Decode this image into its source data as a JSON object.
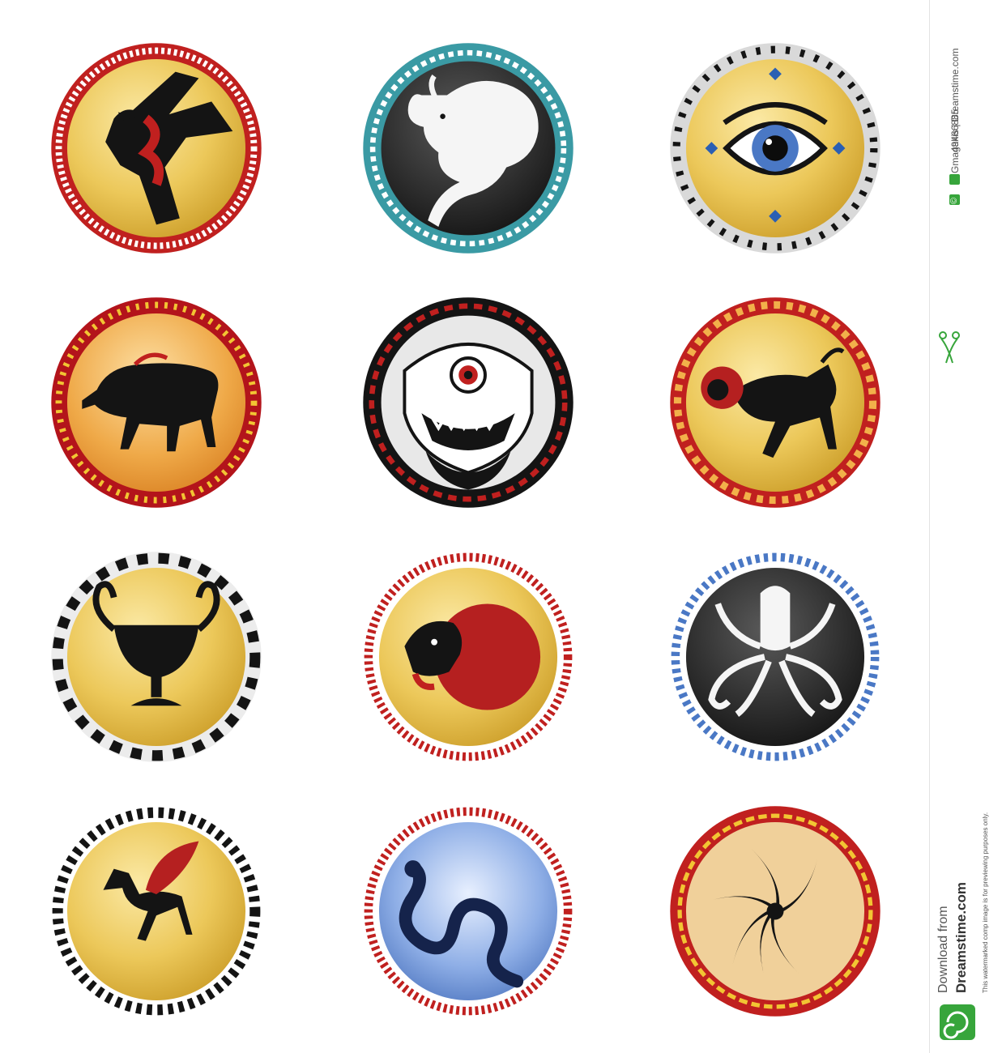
{
  "shields": [
    {
      "motif": "eagle-icon"
    },
    {
      "motif": "bull-icon"
    },
    {
      "motif": "eye-icon"
    },
    {
      "motif": "boar-icon"
    },
    {
      "motif": "gorgon-icon"
    },
    {
      "motif": "chimera-icon"
    },
    {
      "motif": "kylix-icon"
    },
    {
      "motif": "lion-head-icon"
    },
    {
      "motif": "octopus-icon"
    },
    {
      "motif": "pegasus-icon"
    },
    {
      "motif": "serpent-icon"
    },
    {
      "motif": "whirl-icon"
    }
  ],
  "watermark": {
    "id_label": "ID",
    "id_number": "49466885",
    "copyright_symbol": "©",
    "credit": "Gmagakis | Dreamstime.com",
    "download_line1": "Download from",
    "download_line2": "Dreamstime.com",
    "disclaimer": "This watermarked comp image is for previewing purposes only.",
    "overlay_text": "dreamstime"
  },
  "colors": {
    "gold": "#eac654",
    "gold_dark": "#c99a25",
    "orange": "#e8962f",
    "black": "#141414",
    "red": "#c0201f",
    "teal": "#3a9aa4",
    "blue": "#4a78c5",
    "watermark_green": "#37a53b"
  }
}
